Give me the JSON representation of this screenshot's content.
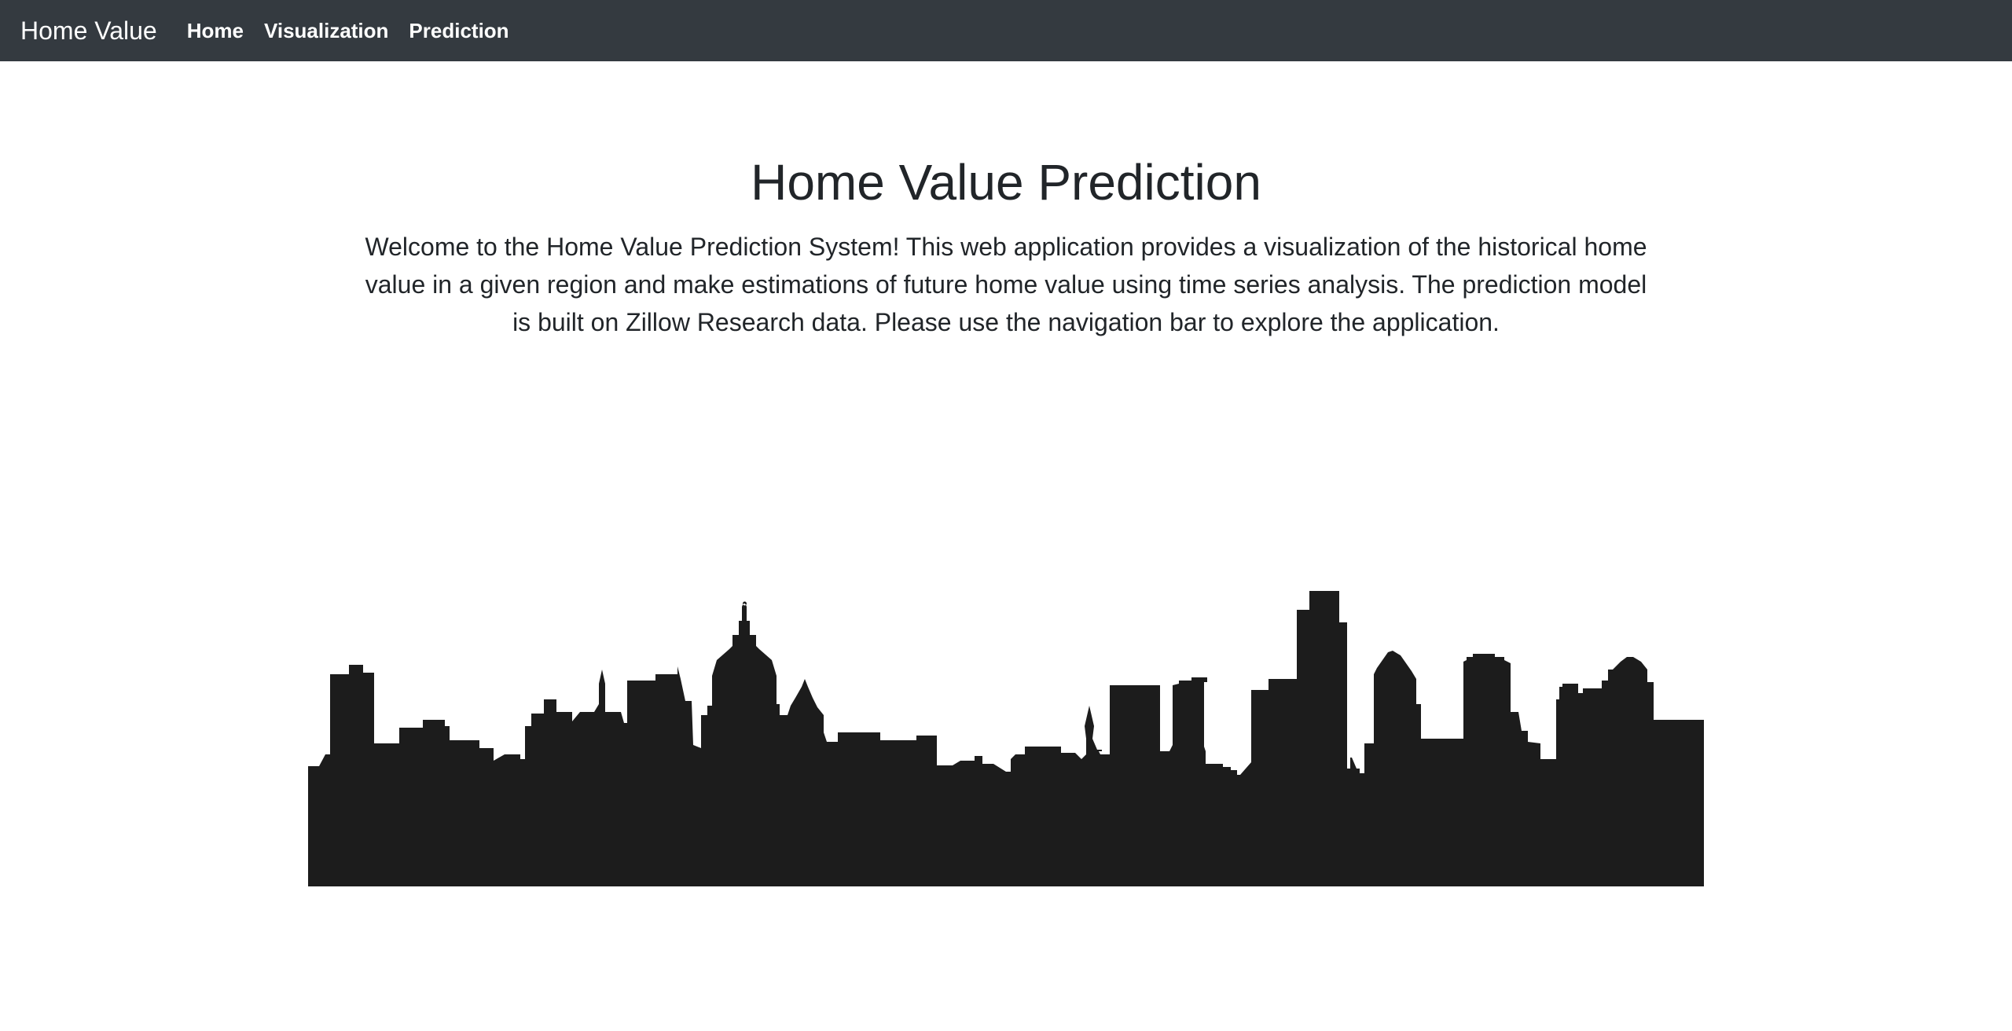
{
  "navbar": {
    "brand": "Home Value",
    "links": [
      {
        "label": "Home"
      },
      {
        "label": "Visualization"
      },
      {
        "label": "Prediction"
      }
    ]
  },
  "main": {
    "title": "Home Value Prediction",
    "intro": "Welcome to the Home Value Prediction System! This web application provides a visualization of the historical home value in a given region and make estimations of future home value using time series analysis. The prediction model is built on Zillow Research data. Please use the navigation bar to explore the application."
  },
  "colors": {
    "navbar_bg": "#343a40",
    "nav_text": "#ffffff",
    "body_text": "#212529",
    "skyline": "#1c1c1c"
  }
}
